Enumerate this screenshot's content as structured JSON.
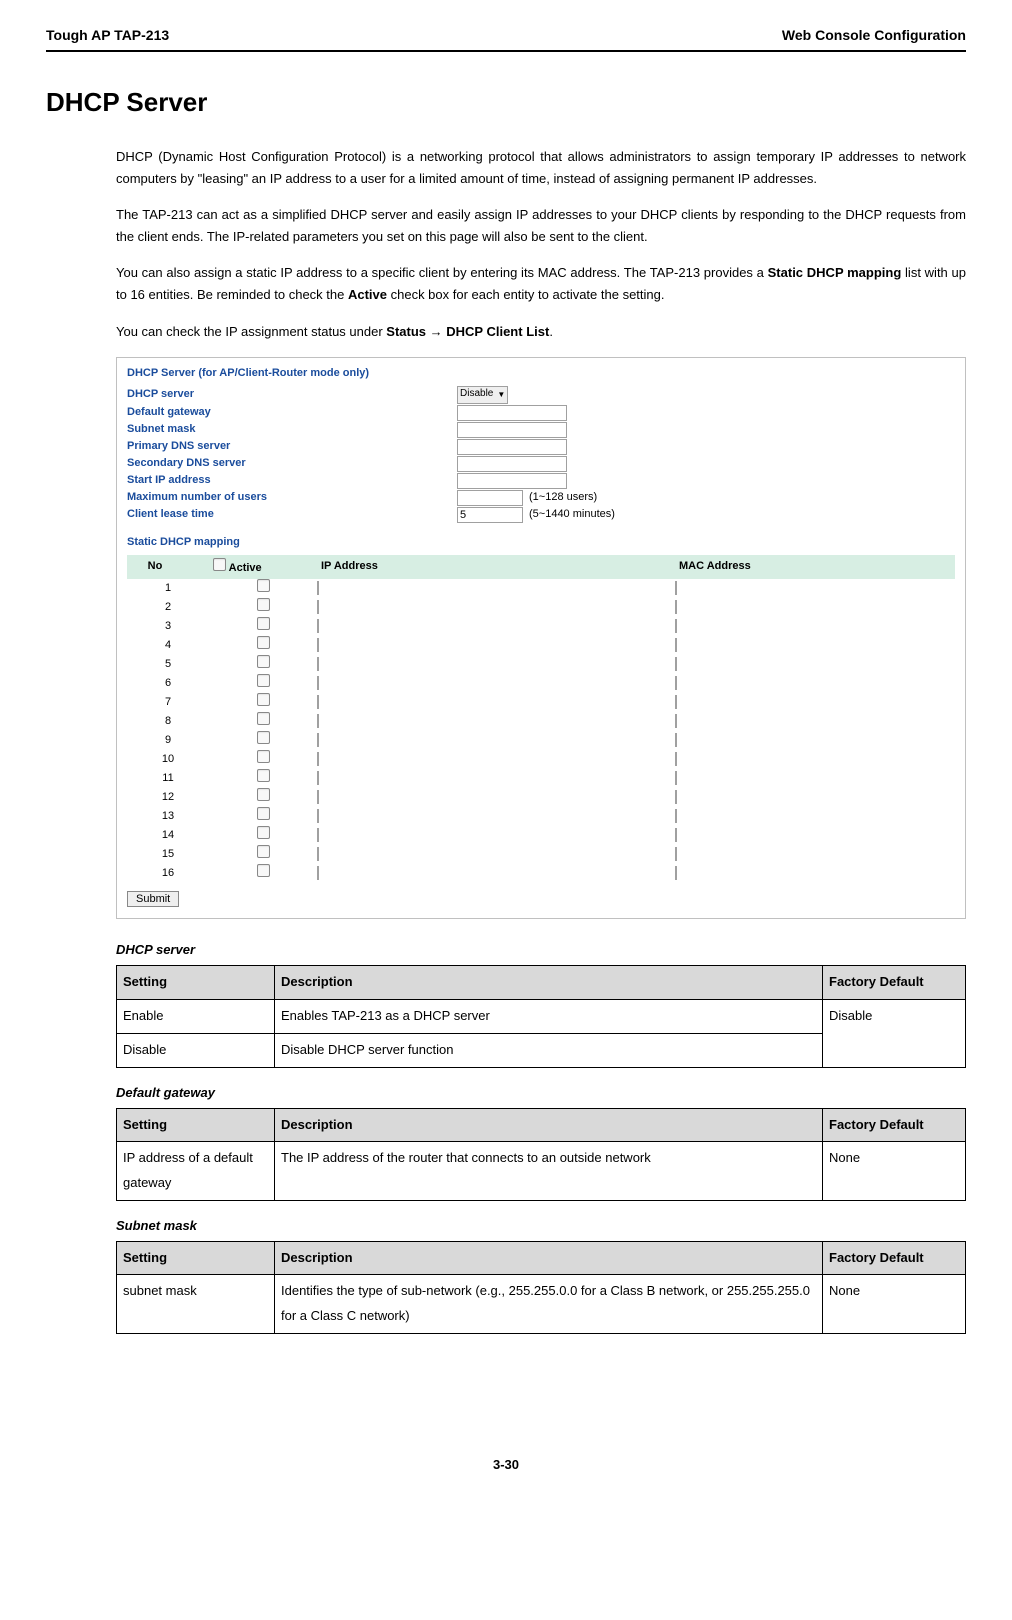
{
  "header": {
    "left": "Tough AP TAP-213",
    "right": "Web Console Configuration"
  },
  "title": "DHCP Server",
  "para1": "DHCP (Dynamic Host Configuration Protocol) is a networking protocol that allows administrators to assign temporary IP addresses to network computers by \"leasing\" an IP address to a user for a limited amount of time, instead of assigning permanent IP addresses.",
  "para2": "The TAP-213 can act as a simplified DHCP server and easily assign IP addresses to your DHCP clients by responding to the DHCP requests from the client ends. The IP-related parameters you set on this page will also be sent to the client.",
  "para3_a": "You can also assign a static IP address to a specific client by entering its MAC address. The TAP-213 provides a ",
  "para3_b": "Static DHCP mapping",
  "para3_c": " list with up to 16 entities. Be reminded to check the ",
  "para3_d": "Active",
  "para3_e": " check box for each entity to activate the setting.",
  "para4_a": "You can check the IP assignment status under ",
  "para4_b": "Status ",
  "para4_arrow": "→",
  "para4_c": " DHCP Client List",
  "para4_d": ".",
  "figure": {
    "heading": "DHCP Server (for AP/Client-Router mode only)",
    "rows": {
      "dhcp_server": "DHCP server",
      "default_gateway": "Default gateway",
      "subnet_mask": "Subnet mask",
      "primary_dns": "Primary DNS server",
      "secondary_dns": "Secondary DNS server",
      "start_ip": "Start IP address",
      "max_users": "Maximum number of users",
      "lease_time": "Client lease time"
    },
    "select_value": "Disable",
    "users_note": "(1~128 users)",
    "lease_value": "5",
    "lease_note": "(5~1440 minutes)",
    "mapping_heading": "Static DHCP mapping",
    "columns": {
      "no": "No",
      "active": "Active",
      "ip": "IP Address",
      "mac": "MAC Address"
    },
    "row_numbers": [
      "1",
      "2",
      "3",
      "4",
      "5",
      "6",
      "7",
      "8",
      "9",
      "10",
      "11",
      "12",
      "13",
      "14",
      "15",
      "16"
    ],
    "submit": "Submit"
  },
  "tables": {
    "col_setting": "Setting",
    "col_desc": "Description",
    "col_default": "Factory Default",
    "t1": {
      "title": "DHCP server",
      "r1s": "Enable",
      "r1d": "Enables TAP-213 as a DHCP server",
      "r2s": "Disable",
      "r2d": "Disable DHCP server function",
      "default": "Disable"
    },
    "t2": {
      "title": "Default gateway",
      "r1s": "IP address of a default gateway",
      "r1d": "The IP address of the router that connects to an outside network",
      "default": "None"
    },
    "t3": {
      "title": "Subnet mask",
      "r1s": "subnet mask",
      "r1d": "Identifies the type of sub-network (e.g., 255.255.0.0 for a Class B network, or 255.255.255.0 for a Class C network)",
      "default": "None"
    }
  },
  "footer": "3-30"
}
